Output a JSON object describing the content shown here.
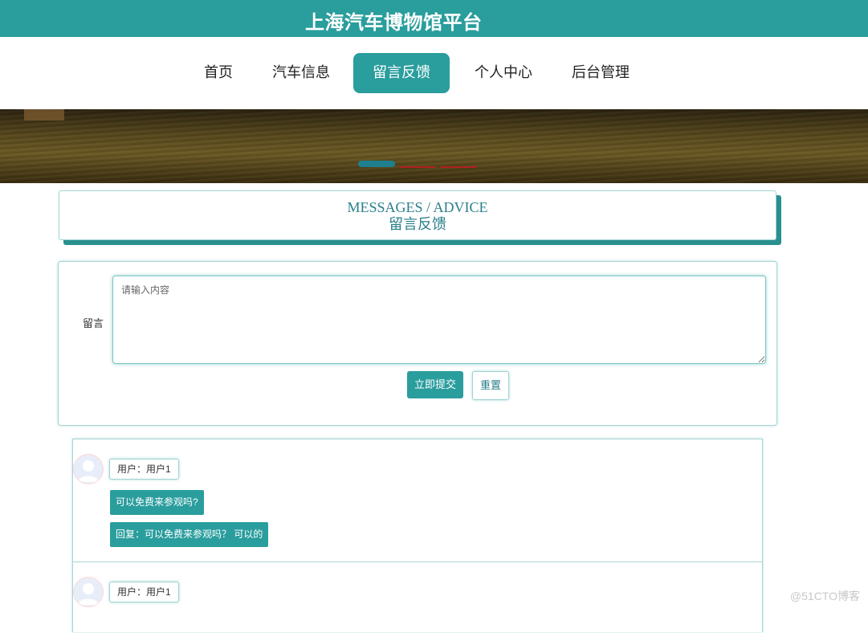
{
  "header": {
    "site_title": "上海汽车博物馆平台",
    "brand_color": "#2a9d9d"
  },
  "nav": {
    "items": [
      {
        "label": "首页",
        "active": false
      },
      {
        "label": "汽车信息",
        "active": false
      },
      {
        "label": "留言反馈",
        "active": true
      },
      {
        "label": "个人中心",
        "active": false
      },
      {
        "label": "后台管理",
        "active": false
      }
    ]
  },
  "carousel": {
    "slide_count": 3,
    "active_index": 0
  },
  "section_heading": {
    "title_en": "MESSAGES / ADVICE",
    "title_cn": "留言反馈"
  },
  "form": {
    "label": "留言",
    "placeholder": "请输入内容",
    "value": "",
    "submit_label": "立即提交",
    "reset_label": "重置"
  },
  "comments": [
    {
      "user": "用户：用户1",
      "message": "可以免费来参观吗?",
      "reply": "回复：可以免费来参观吗？ 可以的"
    },
    {
      "user": "用户：用户1"
    }
  ],
  "watermark": "@51CTO博客"
}
